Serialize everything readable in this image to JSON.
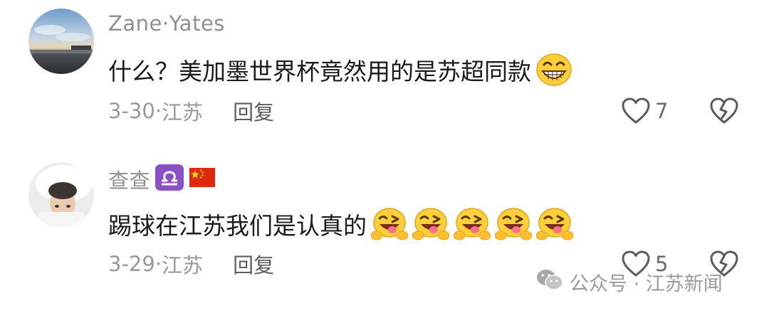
{
  "comments": [
    {
      "user": "Zane·Yates",
      "text": "什么？美加墨世界杯竟然用的是苏超同款",
      "emojis": [
        "grinning-face-icon"
      ],
      "date": "3-30",
      "sep": "·",
      "location": "江苏",
      "reply_label": "回复",
      "likes": "7"
    },
    {
      "user": "查查",
      "badges": [
        "libra-zodiac-icon",
        "china-flag-icon"
      ],
      "text": "踢球在江苏我们是认真的",
      "emojis": [
        "winking-tongue-face-icon",
        "winking-tongue-face-icon",
        "winking-tongue-face-icon",
        "winking-tongue-face-icon",
        "winking-tongue-face-icon"
      ],
      "date": "3-29",
      "sep": "·",
      "location": "江苏",
      "reply_label": "回复",
      "likes": "5"
    }
  ],
  "watermark": {
    "label": "公众号 · 江苏新闻"
  },
  "colors": {
    "zodiac": "#8b4fc7",
    "flag": "#de2910",
    "meta": "#999999"
  }
}
